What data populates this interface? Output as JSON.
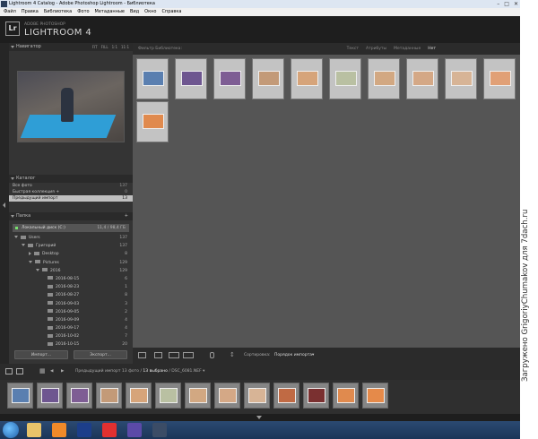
{
  "window": {
    "title": "Lightroom 4 Catalog - Adobe Photoshop Lightroom - Библиотека"
  },
  "menu": [
    "Файл",
    "Правка",
    "Библиотека",
    "Фото",
    "Метаданные",
    "Вид",
    "Окно",
    "Справка"
  ],
  "header": {
    "brand_small": "ADOBE PHOTOSHOP",
    "brand_big": "LIGHTROOM 4",
    "logo": "Lr"
  },
  "navigator": {
    "title": "Навигатор",
    "options": [
      "FIT",
      "FILL",
      "1:1",
      "11:1"
    ]
  },
  "catalog": {
    "title": "Каталог",
    "items": [
      {
        "label": "Все фото",
        "count": "137"
      },
      {
        "label": "Быстрая коллекция +",
        "count": "0"
      },
      {
        "label": "Предыдущий импорт",
        "count": "13"
      }
    ]
  },
  "folders": {
    "title": "Папка",
    "plus": "+",
    "volume": {
      "label": "Локальный диск (C:)",
      "count": "11,4 / 98,4 ГБ"
    },
    "items": [
      {
        "label": "Users",
        "count": "137",
        "depth": 0,
        "type": "open"
      },
      {
        "label": "Григорий",
        "count": "137",
        "depth": 1,
        "type": "open"
      },
      {
        "label": "Desktop",
        "count": "8",
        "depth": 2,
        "type": "closed"
      },
      {
        "label": "Pictures",
        "count": "129",
        "depth": 2,
        "type": "open"
      },
      {
        "label": "2016",
        "count": "129",
        "depth": 3,
        "type": "open"
      },
      {
        "label": "2016-08-15",
        "count": "6",
        "depth": 4,
        "type": "leaf"
      },
      {
        "label": "2016-08-23",
        "count": "1",
        "depth": 4,
        "type": "leaf"
      },
      {
        "label": "2016-08-27",
        "count": "8",
        "depth": 4,
        "type": "leaf"
      },
      {
        "label": "2016-09-03",
        "count": "3",
        "depth": 4,
        "type": "leaf"
      },
      {
        "label": "2016-09-05",
        "count": "2",
        "depth": 4,
        "type": "leaf"
      },
      {
        "label": "2016-09-09",
        "count": "4",
        "depth": 4,
        "type": "leaf"
      },
      {
        "label": "2016-09-17",
        "count": "4",
        "depth": 4,
        "type": "leaf"
      },
      {
        "label": "2016-10-02",
        "count": "7",
        "depth": 4,
        "type": "leaf"
      },
      {
        "label": "2016-10-15",
        "count": "20",
        "depth": 4,
        "type": "leaf"
      }
    ]
  },
  "buttons": {
    "import": "Импорт...",
    "export": "Экспорт..."
  },
  "filter": {
    "title": "Фильтр Библиотека:",
    "options": [
      "Текст",
      "Атрибуты",
      "Метаданные",
      "Нет"
    ],
    "active": "Нет"
  },
  "toolbar": {
    "sort_label": "Сортировка:",
    "sort_value": "Порядок импорта"
  },
  "filmstrip": {
    "pages": [
      "1",
      "2"
    ],
    "source": "Предыдущий импорт",
    "counts": "13 фото /",
    "selected": "13 выбрано",
    "file": "/ DSC_6081.NEF"
  },
  "grid": [
    {
      "color": "#5a7fb0",
      "selected": true
    },
    {
      "color": "#6e5690",
      "selected": true
    },
    {
      "color": "#7e5d94",
      "selected": true
    },
    {
      "color": "#c39a78",
      "selected": true
    },
    {
      "color": "#d6a47a",
      "selected": true
    },
    {
      "color": "#b9c0a2",
      "selected": true
    },
    {
      "color": "#d2a882",
      "selected": true
    },
    {
      "color": "#d4a886",
      "selected": true
    },
    {
      "color": "#d7b496",
      "selected": true
    },
    {
      "color": "#e1a076",
      "selected": true
    },
    {
      "color": "#e08a4e",
      "selected": true
    }
  ],
  "film": [
    {
      "color": "#5a7fb0"
    },
    {
      "color": "#6e5690"
    },
    {
      "color": "#7e5d94"
    },
    {
      "color": "#c39a78"
    },
    {
      "color": "#d6a47a"
    },
    {
      "color": "#b9c0a2"
    },
    {
      "color": "#d2a882"
    },
    {
      "color": "#d4a886"
    },
    {
      "color": "#d7b496"
    },
    {
      "color": "#c06a44"
    },
    {
      "color": "#7a3030"
    },
    {
      "color": "#e08a4e"
    },
    {
      "color": "#e58a4a"
    }
  ],
  "watermark": "Загружено GrigoriyChumakov для 7dach.ru",
  "taskbar": [
    {
      "name": "explorer",
      "color": "#e8c36a"
    },
    {
      "name": "media",
      "color": "#f08a2a"
    },
    {
      "name": "photoshop",
      "color": "#1c3e8a"
    },
    {
      "name": "yandex",
      "color": "#e23030"
    },
    {
      "name": "browser",
      "color": "#5b4aa8"
    },
    {
      "name": "lightroom",
      "color": "#3b4c66"
    }
  ]
}
